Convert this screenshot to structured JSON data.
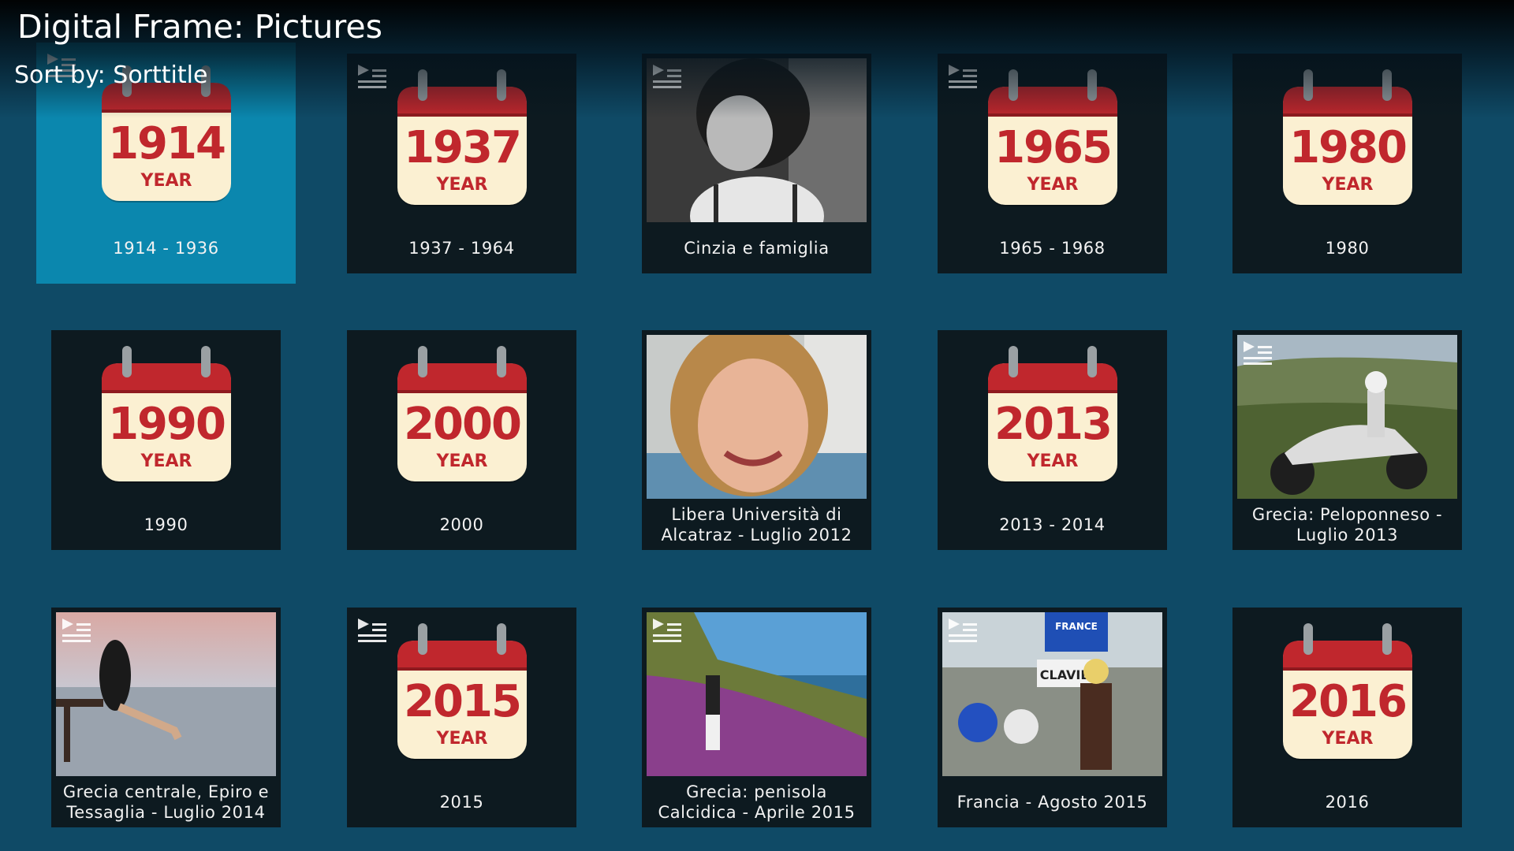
{
  "header": {
    "title": "Digital Frame: Pictures",
    "sort_label": "Sort by: Sorttitle"
  },
  "colors": {
    "background": "#0f4a66",
    "tile": "#0d1a20",
    "focused_tile": "#0b87ae",
    "calendar_red": "#c0272d",
    "calendar_paper": "#fbf0d2"
  },
  "calendar_word": "YEAR",
  "items": [
    {
      "label": "1914 - 1936",
      "type": "calendar",
      "year": "1914",
      "slideshow": true,
      "focused": true
    },
    {
      "label": "1937 - 1964",
      "type": "calendar",
      "year": "1937",
      "slideshow": true
    },
    {
      "label": "Cinzia e famiglia",
      "type": "photo",
      "photo": "black-and-white child portrait",
      "slideshow": true
    },
    {
      "label": "1965 - 1968",
      "type": "calendar",
      "year": "1965",
      "slideshow": true
    },
    {
      "label": "1980",
      "type": "calendar",
      "year": "1980",
      "slideshow": false
    },
    {
      "label": "1990",
      "type": "calendar",
      "year": "1990",
      "slideshow": false
    },
    {
      "label": "2000",
      "type": "calendar",
      "year": "2000",
      "slideshow": false
    },
    {
      "label": "Libera Università di Alcatraz - Luglio 2012",
      "type": "photo",
      "photo": "smiling child",
      "slideshow": false
    },
    {
      "label": "2013 - 2014",
      "type": "calendar",
      "year": "2013",
      "slideshow": false
    },
    {
      "label": "Grecia: Peloponneso - Luglio 2013",
      "type": "photo",
      "photo": "motorcycle",
      "slideshow": true
    },
    {
      "label": "Grecia centrale, Epiro e Tessaglia - Luglio 2014",
      "type": "photo",
      "photo": "woman on bench at sea",
      "slideshow": true
    },
    {
      "label": "2015",
      "type": "calendar",
      "year": "2015",
      "slideshow": true
    },
    {
      "label": "Grecia: penisola Calcidica - Aprile 2015",
      "type": "photo",
      "photo": "woman on flowering hillside",
      "slideshow": true
    },
    {
      "label": "Francia - Agosto 2015",
      "type": "photo",
      "photo": "border sign with motorcycles",
      "signs": [
        "FRANCE",
        "CLAVIE"
      ],
      "slideshow": true
    },
    {
      "label": "2016",
      "type": "calendar",
      "year": "2016",
      "slideshow": false
    }
  ]
}
